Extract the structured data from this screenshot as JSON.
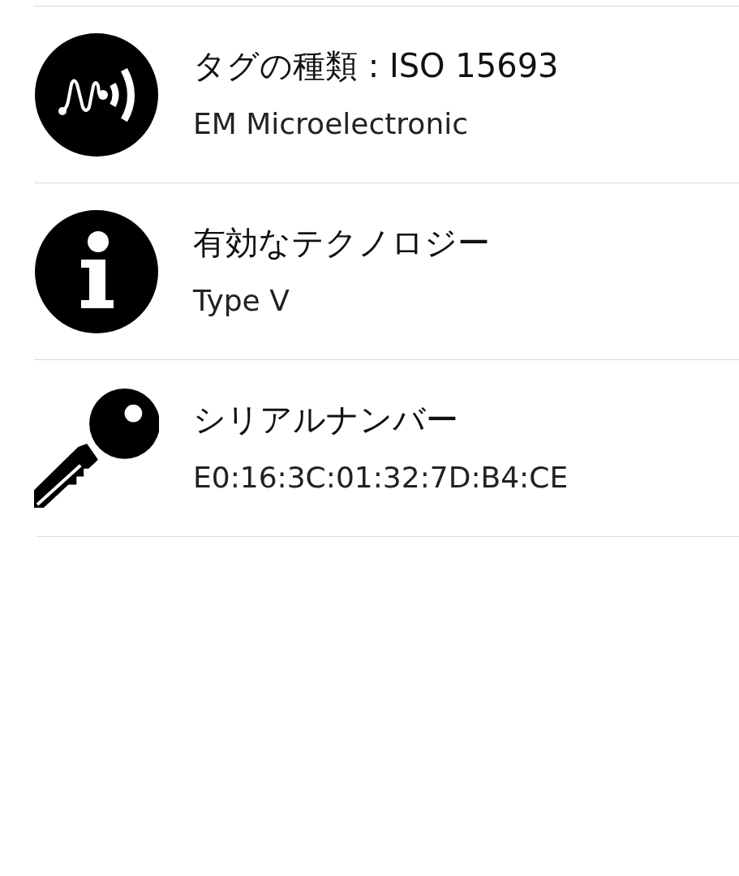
{
  "items": [
    {
      "kind": "nfc",
      "title": "タグの種類 : ISO 15693",
      "subtitle": "EM Microelectronic"
    },
    {
      "kind": "info",
      "title": "有効なテクノロジー",
      "subtitle": "Type V"
    },
    {
      "kind": "key",
      "title": "シリアルナンバー",
      "subtitle": "E0:16:3C:01:32:7D:B4:CE"
    }
  ]
}
